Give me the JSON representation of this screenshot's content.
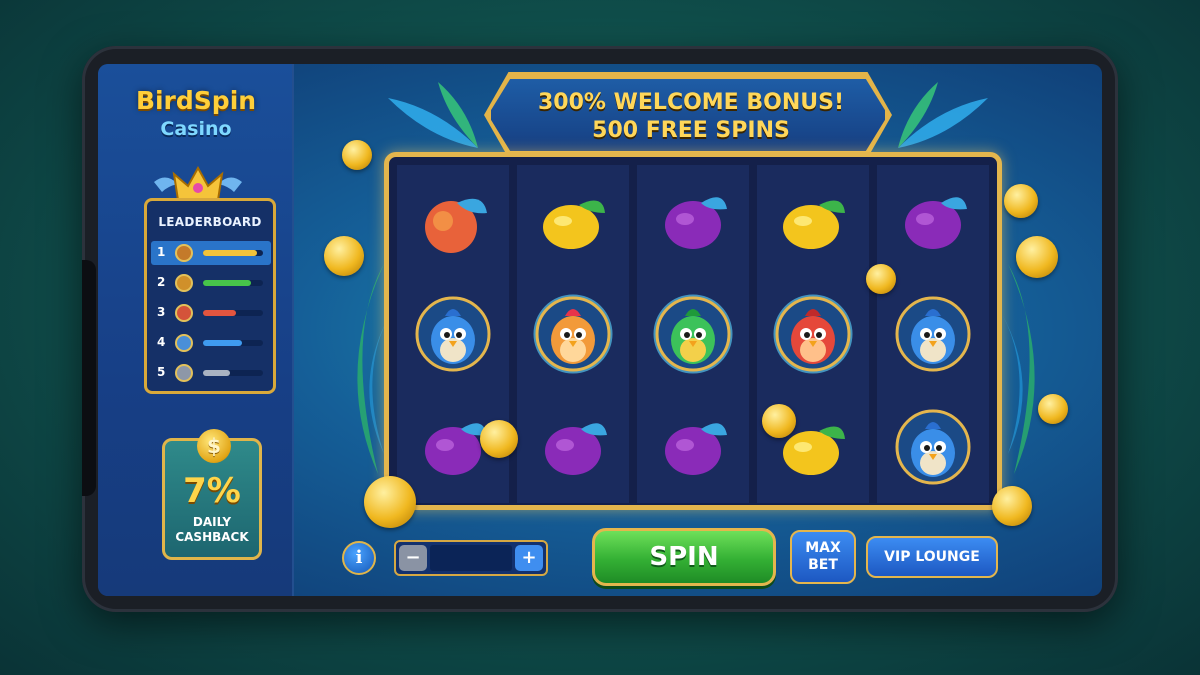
{
  "brand": {
    "name": "BirdSpin",
    "sub": "Casino"
  },
  "leaderboard": {
    "title": "LEADERBOARD",
    "rows": [
      {
        "rank": "1",
        "bar_color": "#f2c33a",
        "avatar_color": "#c47a2a",
        "fill": 0.9
      },
      {
        "rank": "2",
        "bar_color": "#47c44a",
        "avatar_color": "#d0902a",
        "fill": 0.8
      },
      {
        "rank": "3",
        "bar_color": "#e2553f",
        "avatar_color": "#d4533a",
        "fill": 0.55
      },
      {
        "rank": "4",
        "bar_color": "#3f9bf0",
        "avatar_color": "#4a8fd8",
        "fill": 0.65
      },
      {
        "rank": "5",
        "bar_color": "#a9b3c2",
        "avatar_color": "#8d97a8",
        "fill": 0.45
      }
    ]
  },
  "cashback": {
    "percent": "7%",
    "label_line1": "DAILY",
    "label_line2": "CASHBACK",
    "coin_symbol": "$"
  },
  "bonus": {
    "line1": "300% WELCOME BONUS!",
    "line2": "500 FREE SPINS"
  },
  "reels": [
    [
      "peach",
      "blue-bird",
      "plum"
    ],
    [
      "lemon",
      "rooster-bird",
      "plum"
    ],
    [
      "plum",
      "green-parrot",
      "plum"
    ],
    [
      "lemon",
      "red-bird",
      "lemon"
    ],
    [
      "plum",
      "blue-bird",
      "blue-bird"
    ]
  ],
  "controls": {
    "info_symbol": "i",
    "bet_minus": "−",
    "bet_plus": "+",
    "spin_label": "SPIN",
    "maxbet_line1": "MAX",
    "maxbet_line2": "BET",
    "vip_label": "VIP LOUNGE"
  },
  "colors": {
    "gold": "#e4b64d",
    "spin_green": "#34b034",
    "button_blue": "#1d58c2"
  }
}
